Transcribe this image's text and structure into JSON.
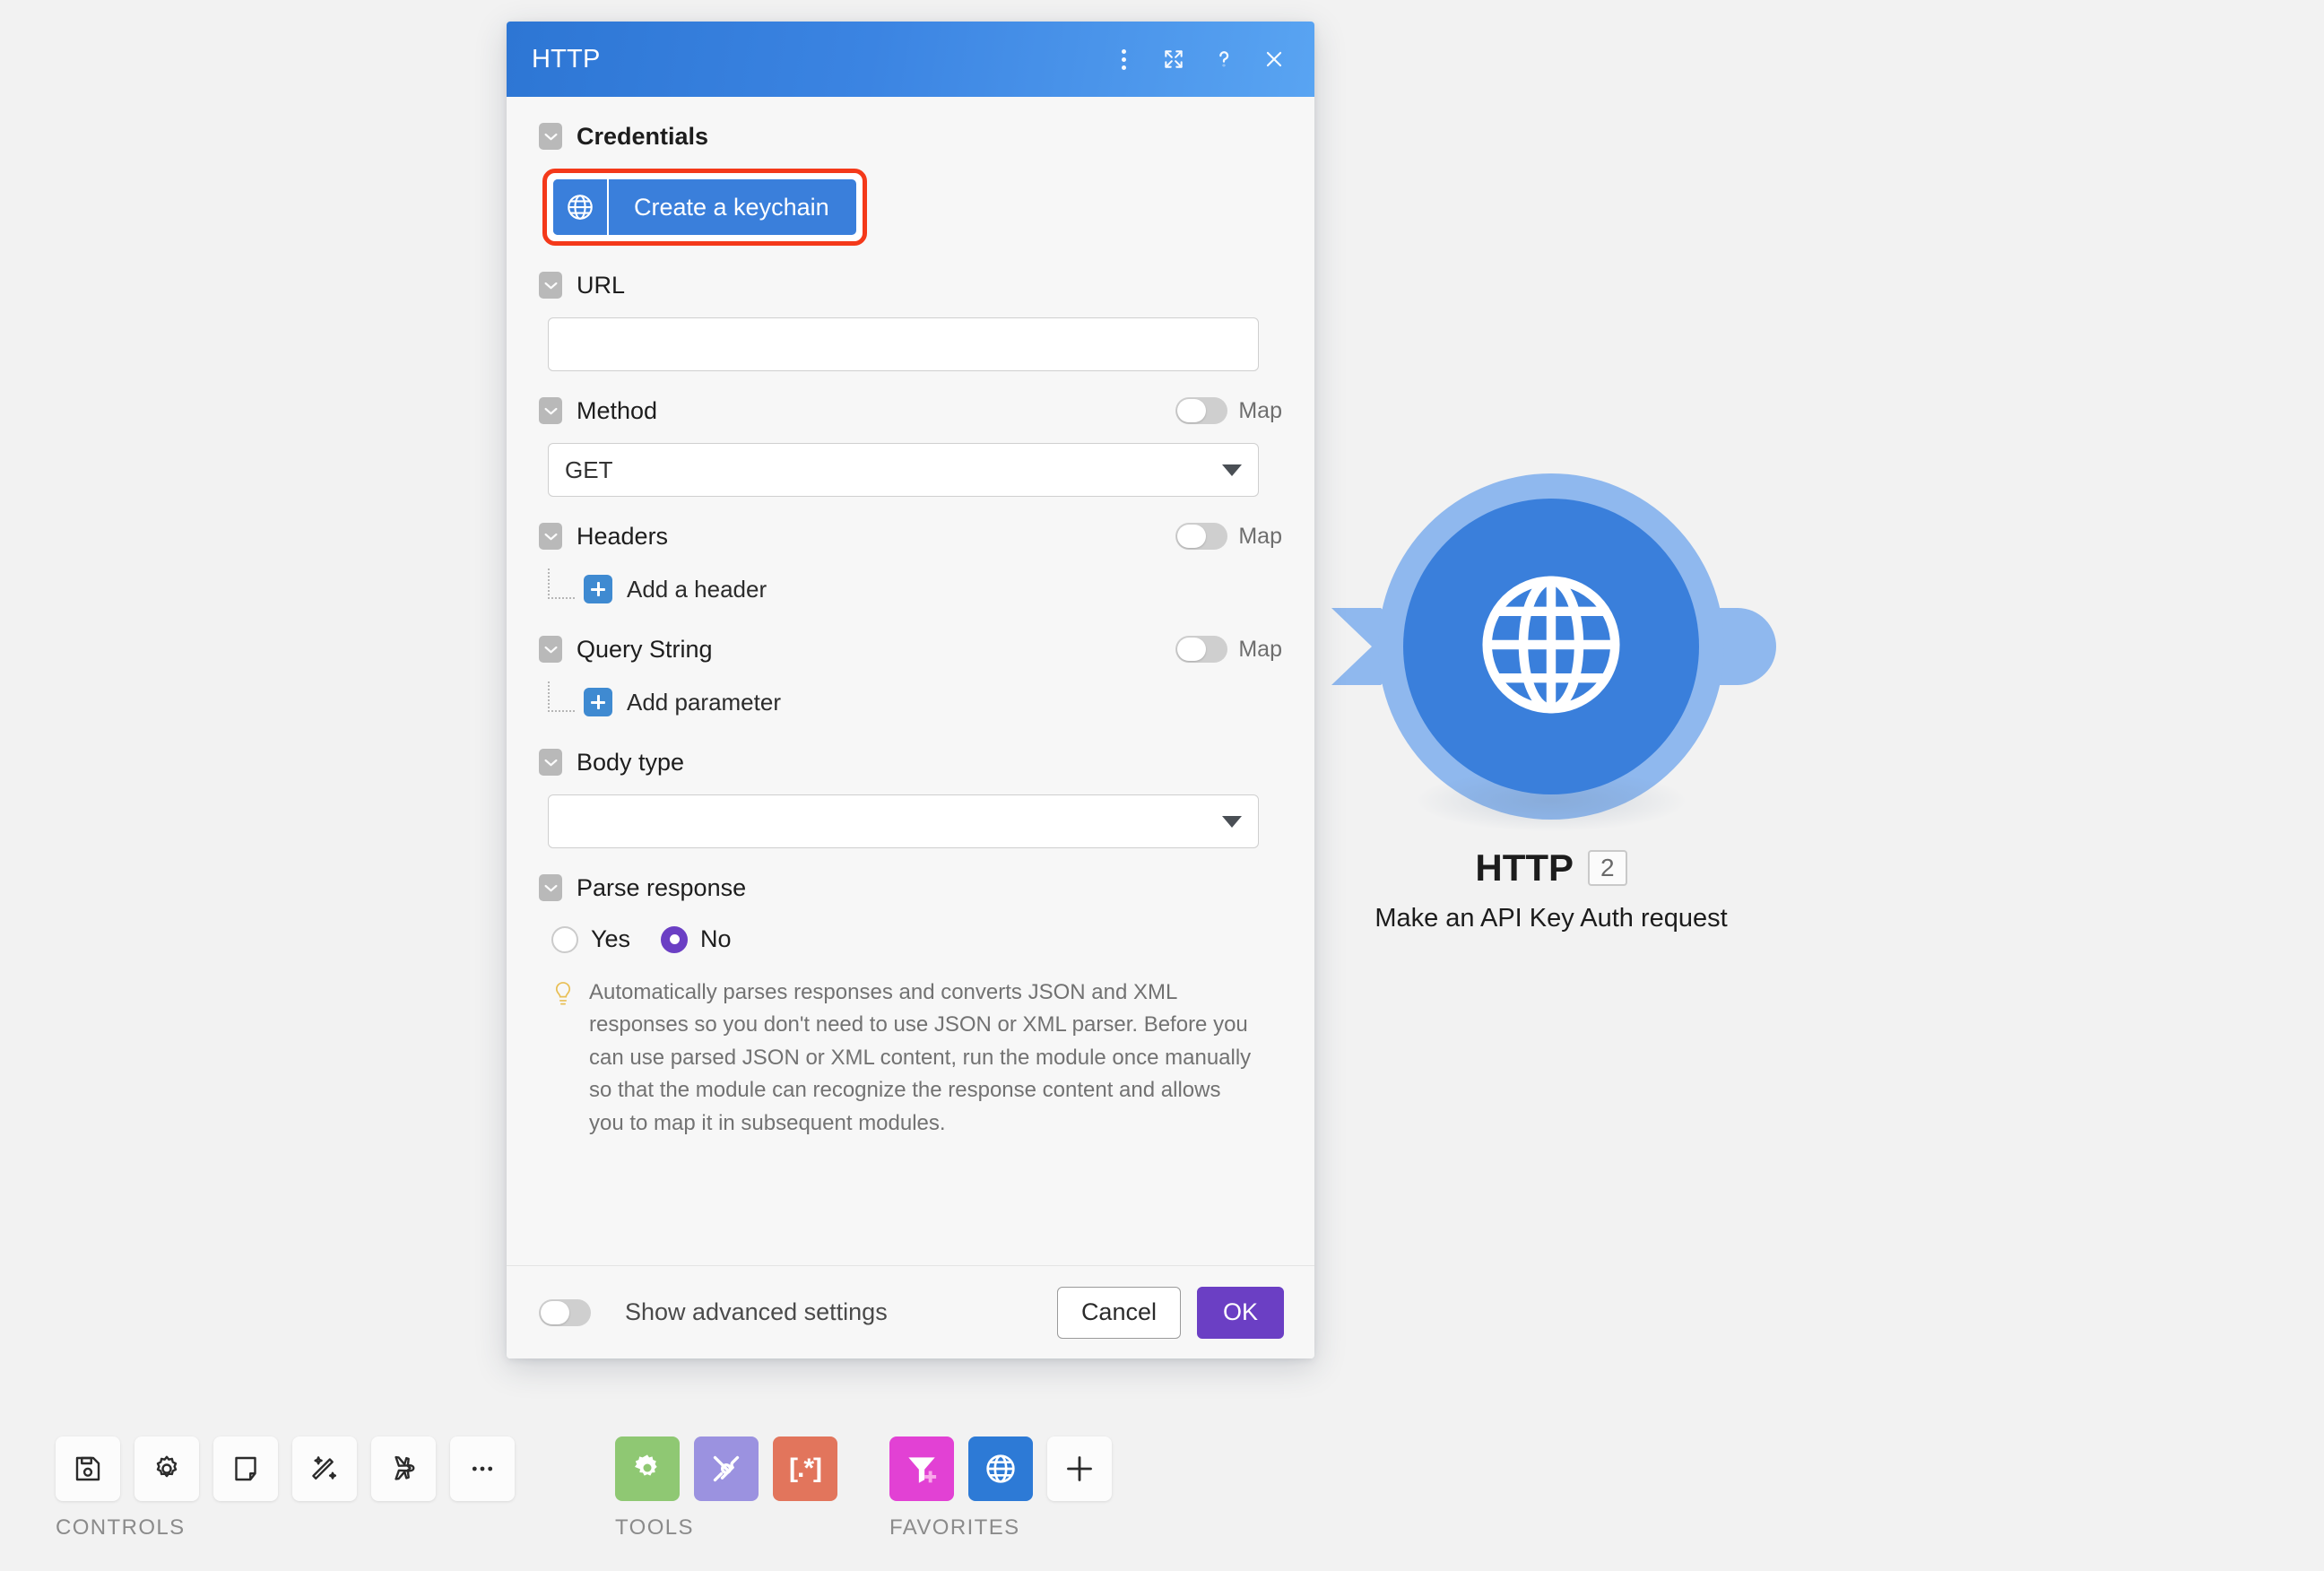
{
  "canvas": {
    "node": {
      "title": "HTTP",
      "count": "2",
      "subtitle": "Make an API Key Auth request",
      "icon": "globe-icon",
      "color": "#3a7fdb",
      "halo_color": "#8fb8ee"
    }
  },
  "dialog": {
    "title": "HTTP",
    "header_gradient_from": "#2d76d4",
    "header_gradient_to": "#59a4f2",
    "actions": [
      {
        "name": "more-options-icon",
        "label": "More options"
      },
      {
        "name": "expand-icon",
        "label": "Expand"
      },
      {
        "name": "help-icon",
        "label": "Help"
      },
      {
        "name": "close-icon",
        "label": "Close"
      }
    ],
    "fields": {
      "credentials": {
        "label": "Credentials",
        "button_label": "Create a keychain",
        "button_icon": "globe-icon",
        "highlight_color": "#f4391a"
      },
      "url": {
        "label": "URL",
        "value": "",
        "placeholder": ""
      },
      "method": {
        "label": "Method",
        "value": "GET",
        "map_label": "Map",
        "map_enabled": false
      },
      "headers": {
        "label": "Headers",
        "add_label": "Add a header",
        "map_label": "Map",
        "map_enabled": false
      },
      "query_string": {
        "label": "Query String",
        "add_label": "Add parameter",
        "map_label": "Map",
        "map_enabled": false
      },
      "body_type": {
        "label": "Body type",
        "value": "",
        "placeholder": ""
      },
      "parse_response": {
        "label": "Parse response",
        "options": [
          {
            "label": "Yes",
            "selected": false
          },
          {
            "label": "No",
            "selected": true
          }
        ],
        "selected_color": "#6b3fc4",
        "hint": "Automatically parses responses and converts JSON and XML responses so you don't need to use JSON or XML parser. Before you can use parsed JSON or XML content, run the module once manually so that the module can recognize the response content and allows you to map it in subsequent modules."
      }
    },
    "footer": {
      "advanced_label": "Show advanced settings",
      "advanced_enabled": false,
      "cancel_label": "Cancel",
      "ok_label": "OK",
      "ok_color": "#6b3fc4"
    }
  },
  "toolbar": {
    "controls": {
      "caption": "CONTROLS",
      "items": [
        {
          "name": "save-icon",
          "label": "Save"
        },
        {
          "name": "gear-icon",
          "label": "Settings"
        },
        {
          "name": "note-icon",
          "label": "Notes"
        },
        {
          "name": "magic-wand-icon",
          "label": "Auto-align"
        },
        {
          "name": "airplane-icon",
          "label": "Run once"
        },
        {
          "name": "ellipsis-icon",
          "label": "More"
        }
      ]
    },
    "tools": {
      "caption": "TOOLS",
      "items": [
        {
          "name": "gear-tool-icon",
          "label": "Tools",
          "color": "#8fc873"
        },
        {
          "name": "wrench-screwdriver-icon",
          "label": "Utilities",
          "color": "#9b92e0"
        },
        {
          "name": "regex-icon",
          "label": "[.*]",
          "color": "#e2755c"
        }
      ]
    },
    "favorites": {
      "caption": "FAVORITES",
      "items": [
        {
          "name": "filter-plus-icon",
          "label": "Filter",
          "color": "#e241d4"
        },
        {
          "name": "globe-icon",
          "label": "HTTP",
          "color": "#2d7ad6"
        },
        {
          "name": "add-icon",
          "label": "Add",
          "color": "#fcfcfc"
        }
      ]
    }
  }
}
